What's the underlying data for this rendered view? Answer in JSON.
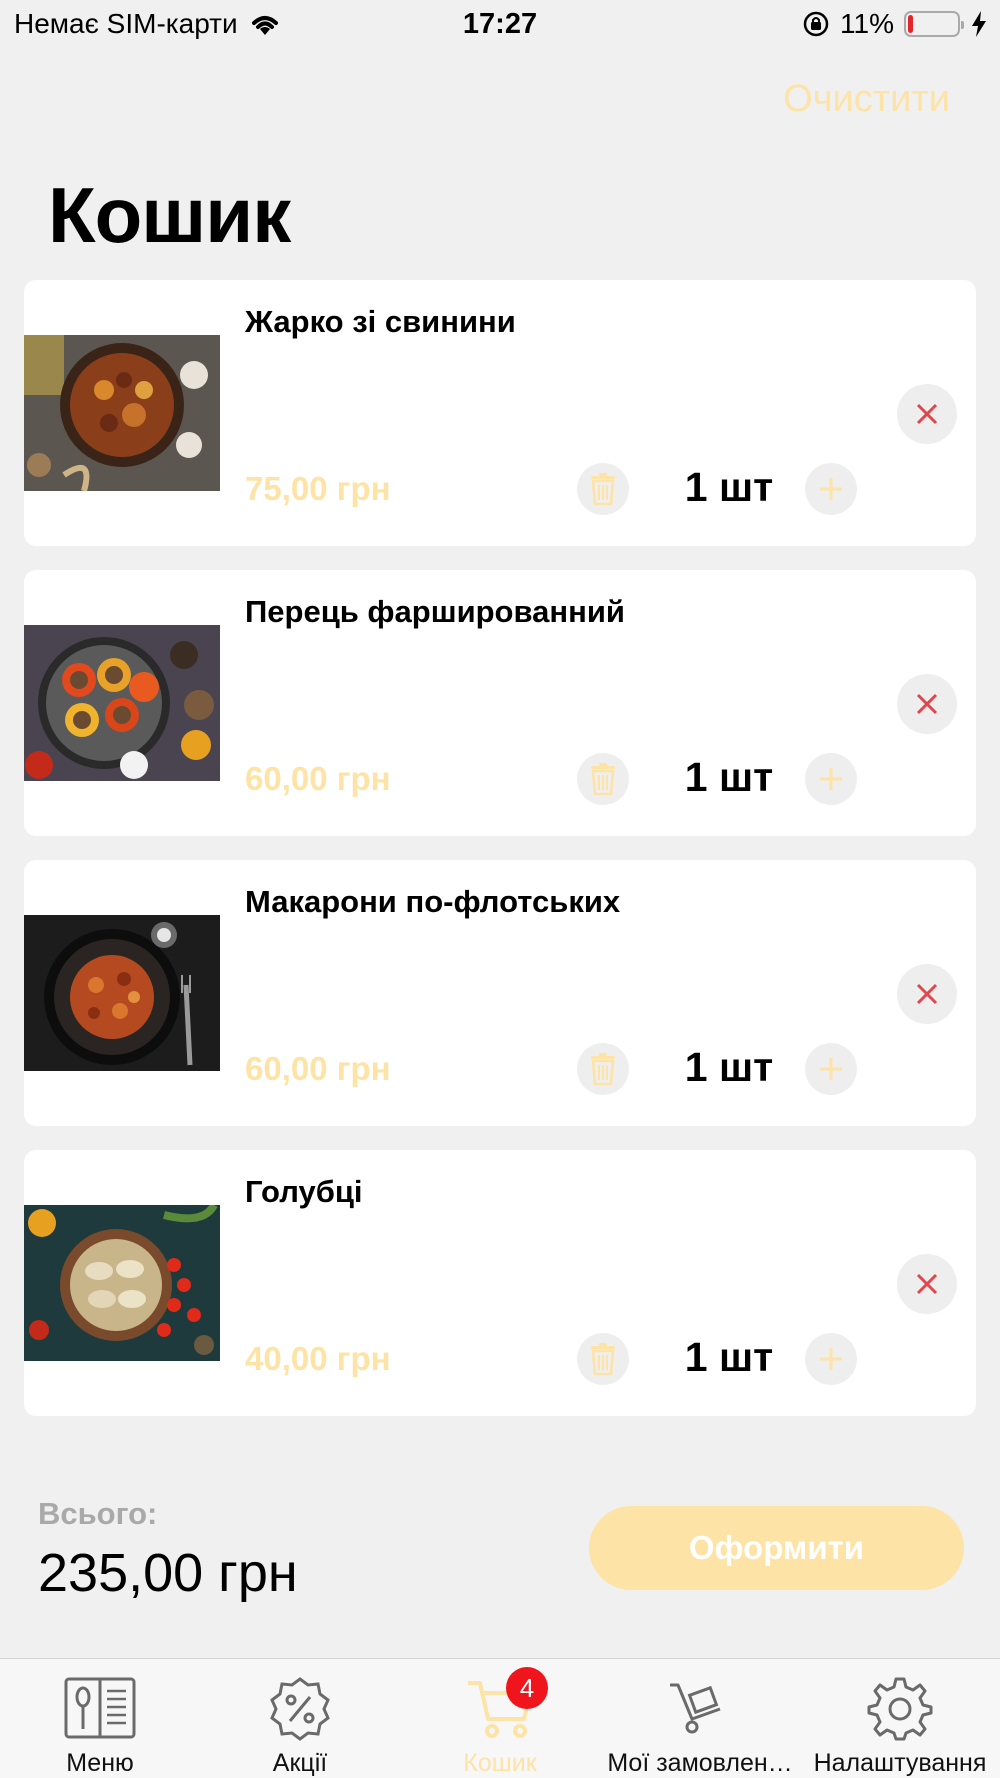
{
  "status_bar": {
    "carrier": "Немає SIM-карти",
    "time": "17:27",
    "battery": "11%",
    "battery_level": 0.11
  },
  "header": {
    "clear_label": "Очистити",
    "title": "Кошик"
  },
  "items": [
    {
      "name": "Жарко зі свинини",
      "price": "75,00 грн",
      "quantity": "1 шт",
      "image": "pork-stew-photo"
    },
    {
      "name": "Перець фаршированний",
      "price": "60,00 грн",
      "quantity": "1 шт",
      "image": "stuffed-peppers-photo"
    },
    {
      "name": "Макарони по-флотських",
      "price": "60,00 грн",
      "quantity": "1 шт",
      "image": "navy-pasta-photo"
    },
    {
      "name": "Голубці",
      "price": "40,00 грн",
      "quantity": "1 шт",
      "image": "cabbage-rolls-photo"
    }
  ],
  "summary": {
    "total_label": "Всього:",
    "total_value": "235,00 грн",
    "checkout_label": "Оформити"
  },
  "tab_bar": {
    "tabs": [
      {
        "label": "Меню",
        "icon": "menu-book-icon"
      },
      {
        "label": "Акції",
        "icon": "discount-badge-icon"
      },
      {
        "label": "Кошик",
        "icon": "cart-icon",
        "badge": "4",
        "active": true
      },
      {
        "label": "Мої замовлен…",
        "icon": "delivery-cart-icon"
      },
      {
        "label": "Налаштування",
        "icon": "gear-icon"
      }
    ]
  },
  "colors": {
    "accent": "#fde3a6",
    "background": "#f0f0f0",
    "badge": "#f0141d",
    "remove": "#e0474c"
  }
}
